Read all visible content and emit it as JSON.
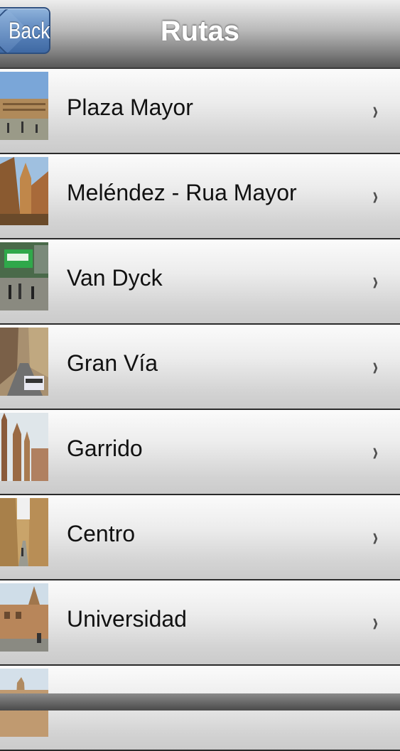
{
  "nav": {
    "title": "Rutas",
    "back_label": "Back"
  },
  "routes": [
    {
      "label": "Plaza Mayor"
    },
    {
      "label": "Meléndez - Rua Mayor"
    },
    {
      "label": "Van Dyck"
    },
    {
      "label": "Gran Vía"
    },
    {
      "label": "Garrido"
    },
    {
      "label": "Centro"
    },
    {
      "label": "Universidad"
    },
    {
      "label": ""
    }
  ],
  "icons": {
    "disclosure": "›"
  },
  "colors": {
    "back_button": "#5c86bd",
    "navbar": "#8a8a8a",
    "row_separator": "#2a2a2a"
  }
}
